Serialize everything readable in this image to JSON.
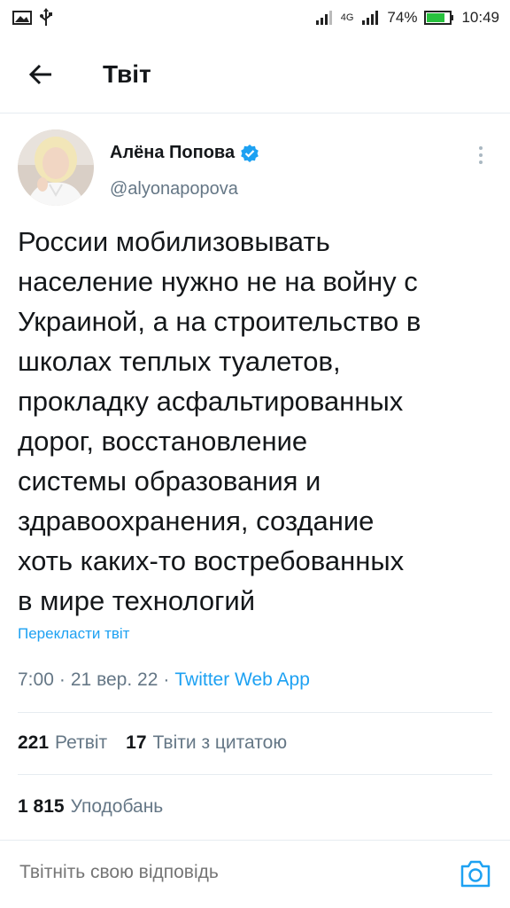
{
  "status_bar": {
    "battery": "74%",
    "time": "10:49",
    "network": "4G"
  },
  "header": {
    "title": "Твіт"
  },
  "tweet": {
    "author_name": "Алёна Попова",
    "author_handle": "@alyonapopova",
    "text": "России мобилизовывать\nнаселение нужно не на войну с\nУкраиной, а на строительство в\nшколах теплых туалетов,\nпрокладку асфальтированных\nдорог, восстановление\nсистемы образования и\nздравоохранения, создание\nхоть каких-то востребованных\nв мире технологий",
    "translate_label": "Перекласти твіт",
    "time": "7:00",
    "date": "21 вер. 22",
    "separator": "·",
    "source": "Twitter Web App"
  },
  "stats": {
    "retweets_count": "221",
    "retweets_label": "Ретвіт",
    "quotes_count": "17",
    "quotes_label": "Твіти з цитатою",
    "likes_count": "1 815",
    "likes_label": "Уподобань"
  },
  "reply": {
    "placeholder": "Твітніть свою відповідь"
  },
  "colors": {
    "accent": "#1da1f2",
    "secondary_text": "#657786",
    "primary_text": "#14171a"
  },
  "icons": [
    "image-icon",
    "usb-icon",
    "signal-icon",
    "battery-icon",
    "back-arrow-icon",
    "verified-icon",
    "more-vertical-icon",
    "camera-icon"
  ]
}
